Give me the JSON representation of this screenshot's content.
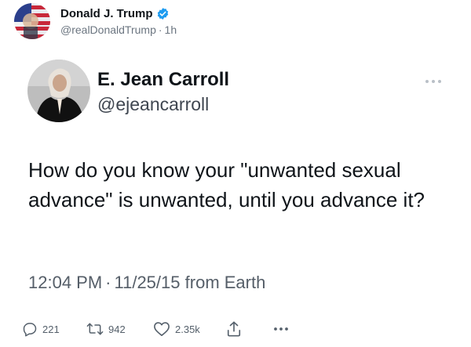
{
  "outer_post": {
    "author_name": "Donald J. Trump",
    "handle": "@realDonaldTrump",
    "separator": "·",
    "time": "1h",
    "verified_icon": "verified-badge-icon",
    "colors": {
      "verified": "#1d9bf0"
    }
  },
  "quoted_tweet": {
    "author_name": "E. Jean Carroll",
    "handle": "@ejeancarroll",
    "text": "How do you know your \"unwanted sexual advance\" is unwanted, until you advance it?",
    "time": "12:04 PM",
    "separator": "·",
    "date": "11/25/15",
    "source": "from Earth",
    "more_icon": "more-dots-icon"
  },
  "actions": {
    "reply": {
      "icon": "reply-icon",
      "count": "221"
    },
    "retweet": {
      "icon": "retweet-icon",
      "count": "942"
    },
    "like": {
      "icon": "heart-icon",
      "count": "2.35k"
    },
    "share": {
      "icon": "share-icon"
    },
    "more": {
      "icon": "more-dots-icon"
    }
  }
}
